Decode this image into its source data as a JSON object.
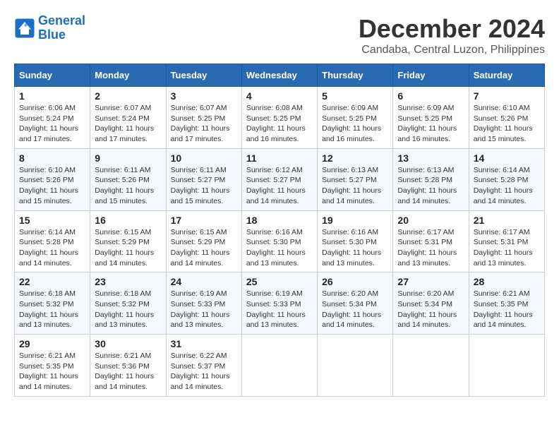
{
  "logo": {
    "line1": "General",
    "line2": "Blue"
  },
  "title": "December 2024",
  "subtitle": "Candaba, Central Luzon, Philippines",
  "weekdays": [
    "Sunday",
    "Monday",
    "Tuesday",
    "Wednesday",
    "Thursday",
    "Friday",
    "Saturday"
  ],
  "weeks": [
    [
      {
        "day": "1",
        "sunrise": "6:06 AM",
        "sunset": "5:24 PM",
        "daylight": "11 hours and 17 minutes."
      },
      {
        "day": "2",
        "sunrise": "6:07 AM",
        "sunset": "5:24 PM",
        "daylight": "11 hours and 17 minutes."
      },
      {
        "day": "3",
        "sunrise": "6:07 AM",
        "sunset": "5:25 PM",
        "daylight": "11 hours and 17 minutes."
      },
      {
        "day": "4",
        "sunrise": "6:08 AM",
        "sunset": "5:25 PM",
        "daylight": "11 hours and 16 minutes."
      },
      {
        "day": "5",
        "sunrise": "6:09 AM",
        "sunset": "5:25 PM",
        "daylight": "11 hours and 16 minutes."
      },
      {
        "day": "6",
        "sunrise": "6:09 AM",
        "sunset": "5:25 PM",
        "daylight": "11 hours and 16 minutes."
      },
      {
        "day": "7",
        "sunrise": "6:10 AM",
        "sunset": "5:26 PM",
        "daylight": "11 hours and 15 minutes."
      }
    ],
    [
      {
        "day": "8",
        "sunrise": "6:10 AM",
        "sunset": "5:26 PM",
        "daylight": "11 hours and 15 minutes."
      },
      {
        "day": "9",
        "sunrise": "6:11 AM",
        "sunset": "5:26 PM",
        "daylight": "11 hours and 15 minutes."
      },
      {
        "day": "10",
        "sunrise": "6:11 AM",
        "sunset": "5:27 PM",
        "daylight": "11 hours and 15 minutes."
      },
      {
        "day": "11",
        "sunrise": "6:12 AM",
        "sunset": "5:27 PM",
        "daylight": "11 hours and 14 minutes."
      },
      {
        "day": "12",
        "sunrise": "6:13 AM",
        "sunset": "5:27 PM",
        "daylight": "11 hours and 14 minutes."
      },
      {
        "day": "13",
        "sunrise": "6:13 AM",
        "sunset": "5:28 PM",
        "daylight": "11 hours and 14 minutes."
      },
      {
        "day": "14",
        "sunrise": "6:14 AM",
        "sunset": "5:28 PM",
        "daylight": "11 hours and 14 minutes."
      }
    ],
    [
      {
        "day": "15",
        "sunrise": "6:14 AM",
        "sunset": "5:28 PM",
        "daylight": "11 hours and 14 minutes."
      },
      {
        "day": "16",
        "sunrise": "6:15 AM",
        "sunset": "5:29 PM",
        "daylight": "11 hours and 14 minutes."
      },
      {
        "day": "17",
        "sunrise": "6:15 AM",
        "sunset": "5:29 PM",
        "daylight": "11 hours and 14 minutes."
      },
      {
        "day": "18",
        "sunrise": "6:16 AM",
        "sunset": "5:30 PM",
        "daylight": "11 hours and 13 minutes."
      },
      {
        "day": "19",
        "sunrise": "6:16 AM",
        "sunset": "5:30 PM",
        "daylight": "11 hours and 13 minutes."
      },
      {
        "day": "20",
        "sunrise": "6:17 AM",
        "sunset": "5:31 PM",
        "daylight": "11 hours and 13 minutes."
      },
      {
        "day": "21",
        "sunrise": "6:17 AM",
        "sunset": "5:31 PM",
        "daylight": "11 hours and 13 minutes."
      }
    ],
    [
      {
        "day": "22",
        "sunrise": "6:18 AM",
        "sunset": "5:32 PM",
        "daylight": "11 hours and 13 minutes."
      },
      {
        "day": "23",
        "sunrise": "6:18 AM",
        "sunset": "5:32 PM",
        "daylight": "11 hours and 13 minutes."
      },
      {
        "day": "24",
        "sunrise": "6:19 AM",
        "sunset": "5:33 PM",
        "daylight": "11 hours and 13 minutes."
      },
      {
        "day": "25",
        "sunrise": "6:19 AM",
        "sunset": "5:33 PM",
        "daylight": "11 hours and 13 minutes."
      },
      {
        "day": "26",
        "sunrise": "6:20 AM",
        "sunset": "5:34 PM",
        "daylight": "11 hours and 14 minutes."
      },
      {
        "day": "27",
        "sunrise": "6:20 AM",
        "sunset": "5:34 PM",
        "daylight": "11 hours and 14 minutes."
      },
      {
        "day": "28",
        "sunrise": "6:21 AM",
        "sunset": "5:35 PM",
        "daylight": "11 hours and 14 minutes."
      }
    ],
    [
      {
        "day": "29",
        "sunrise": "6:21 AM",
        "sunset": "5:35 PM",
        "daylight": "11 hours and 14 minutes."
      },
      {
        "day": "30",
        "sunrise": "6:21 AM",
        "sunset": "5:36 PM",
        "daylight": "11 hours and 14 minutes."
      },
      {
        "day": "31",
        "sunrise": "6:22 AM",
        "sunset": "5:37 PM",
        "daylight": "11 hours and 14 minutes."
      },
      null,
      null,
      null,
      null
    ]
  ],
  "labels": {
    "sunrise_prefix": "Sunrise: ",
    "sunset_prefix": "Sunset: ",
    "daylight_prefix": "Daylight: "
  }
}
